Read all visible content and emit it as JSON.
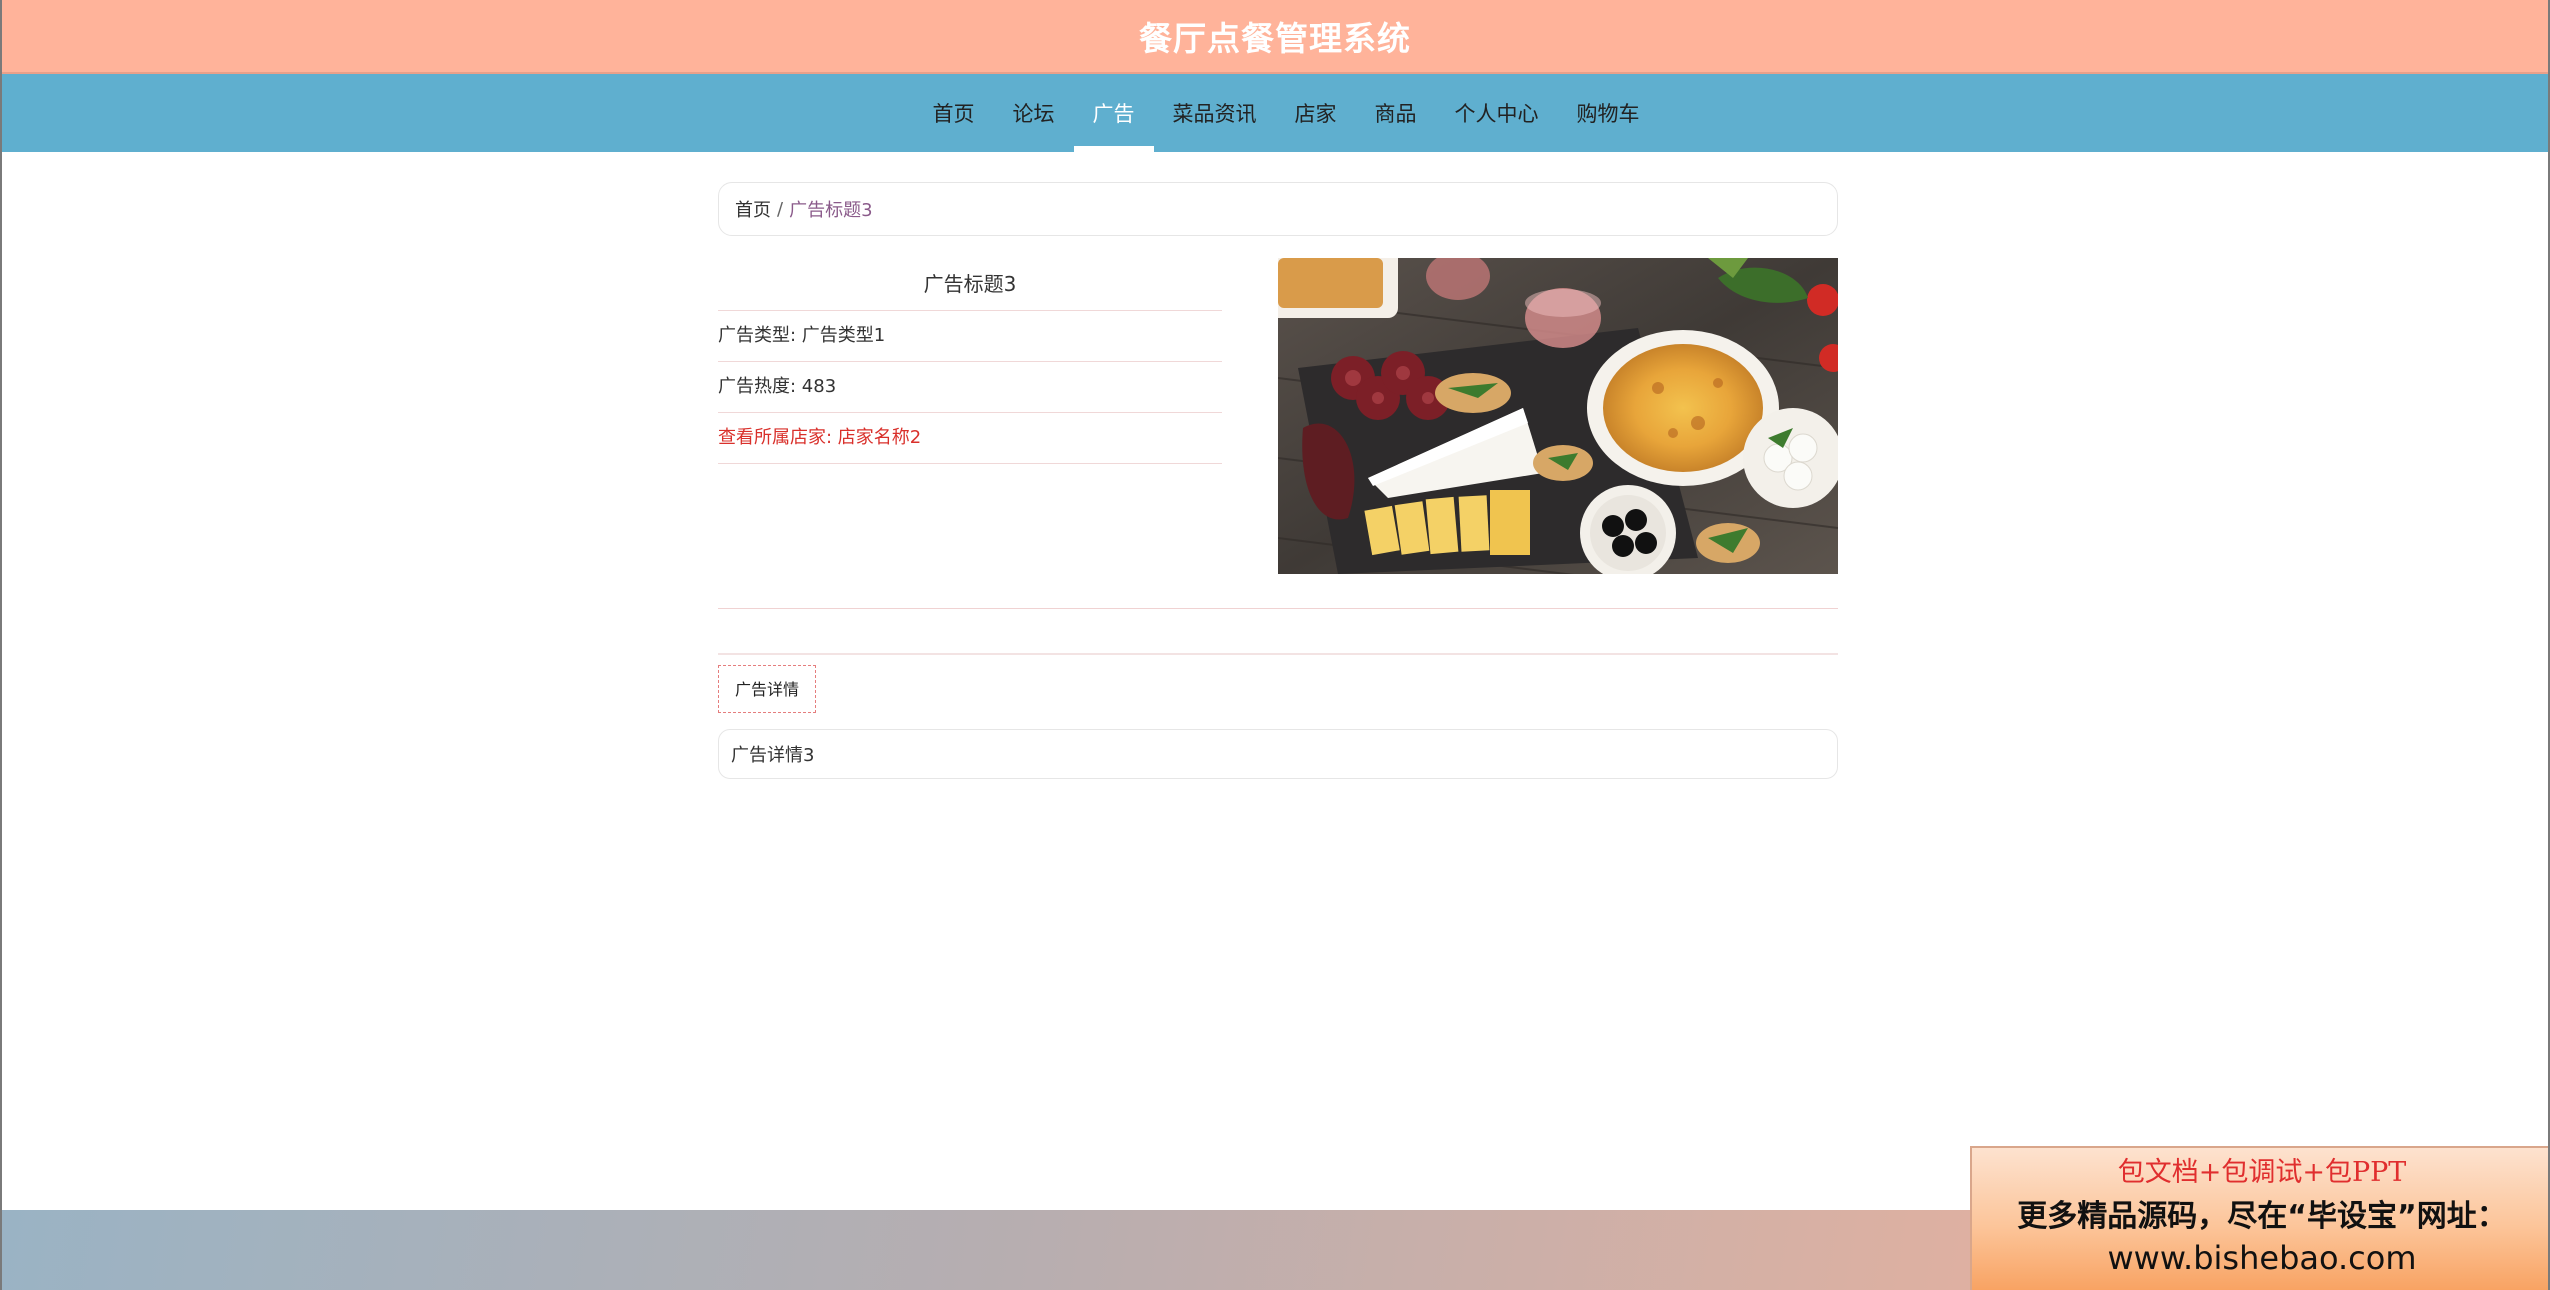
{
  "header": {
    "title": "餐厅点餐管理系统"
  },
  "nav": {
    "items": [
      {
        "label": "首页"
      },
      {
        "label": "论坛"
      },
      {
        "label": "广告"
      },
      {
        "label": "菜品资讯"
      },
      {
        "label": "店家"
      },
      {
        "label": "商品"
      },
      {
        "label": "个人中心"
      },
      {
        "label": "购物车"
      }
    ],
    "active": "广告"
  },
  "breadcrumb": {
    "home": "首页",
    "separator": "/",
    "current": "广告标题3"
  },
  "ad": {
    "title": "广告标题3",
    "type_row": "广告类型: 广告类型1",
    "heat_row": "广告热度: 483",
    "shop_link": "查看所属店家: 店家名称2",
    "image_alt": "food platter photo"
  },
  "detail": {
    "tab_label": "广告详情",
    "content": "广告详情3"
  },
  "banner": {
    "line1": "包文档+包调试+包PPT",
    "line2": "更多精品源码，尽在“毕设宝”网址：",
    "line3": "www.bishebao.com"
  },
  "colors": {
    "topbar": "#ffb39a",
    "navbar": "#5fafcf",
    "link_red": "#d9302b"
  }
}
